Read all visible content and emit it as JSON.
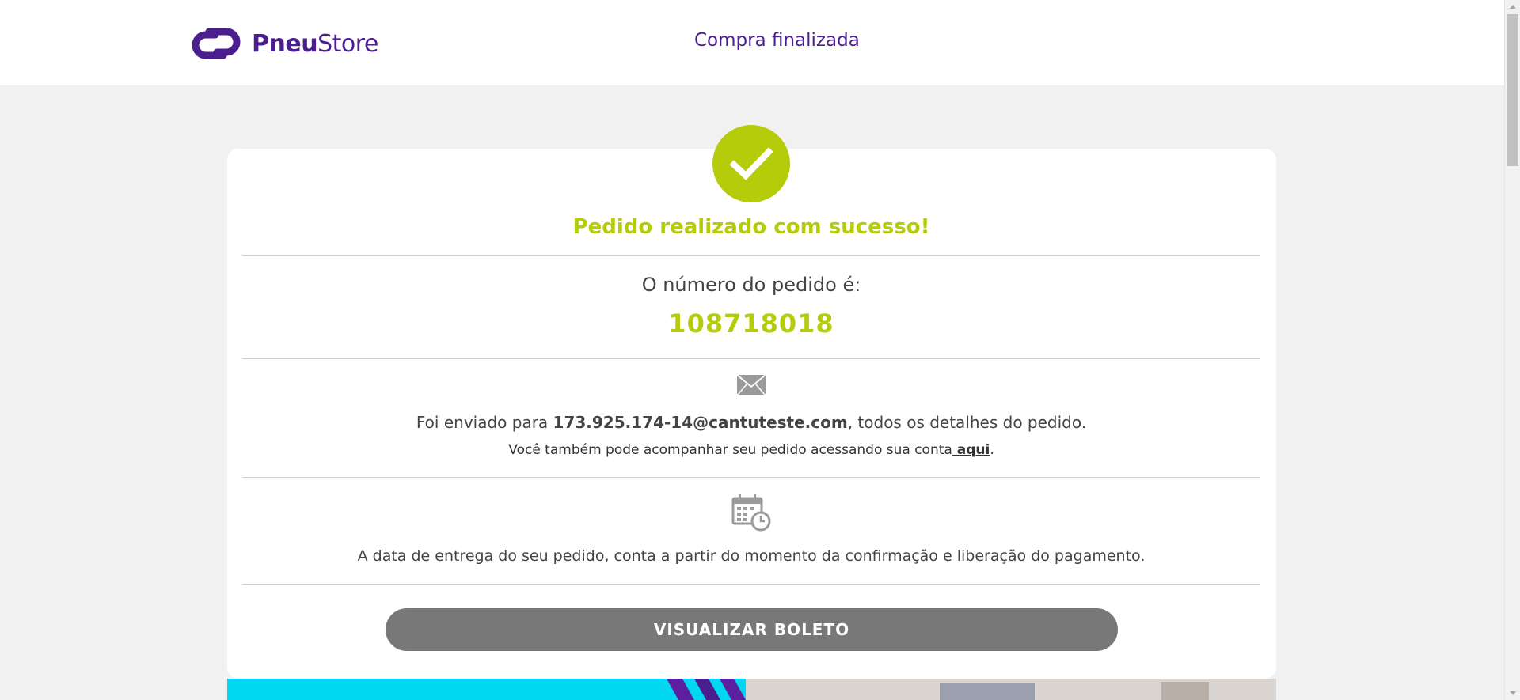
{
  "header": {
    "brand_bold": "Pneu",
    "brand_light": "Store",
    "title": "Compra finalizada"
  },
  "confirmation": {
    "success_message": "Pedido realizado com sucesso!",
    "order_label": "O número do pedido é:",
    "order_number": "108718018",
    "email_prefix": "Foi enviado para ",
    "email": "173.925.174-14@cantuteste.com",
    "email_suffix": ", todos os detalhes do pedido.",
    "account_text": "Você também pode acompanhar seu pedido acessando sua conta",
    "account_link": " aqui",
    "account_end": ".",
    "delivery_text": "A data de entrega do seu pedido, conta a partir do momento da confirmação e liberação do pagamento.",
    "boleto_button": "VISUALIZAR BOLETO"
  },
  "icons": {
    "logo": "pneustore-logo-icon",
    "success": "check-icon",
    "email": "envelope-icon",
    "delivery": "calendar-clock-icon"
  },
  "colors": {
    "brand": "#4b1e8e",
    "success": "#b4cc0a",
    "button": "#787878",
    "banner": "#00d7f0"
  }
}
